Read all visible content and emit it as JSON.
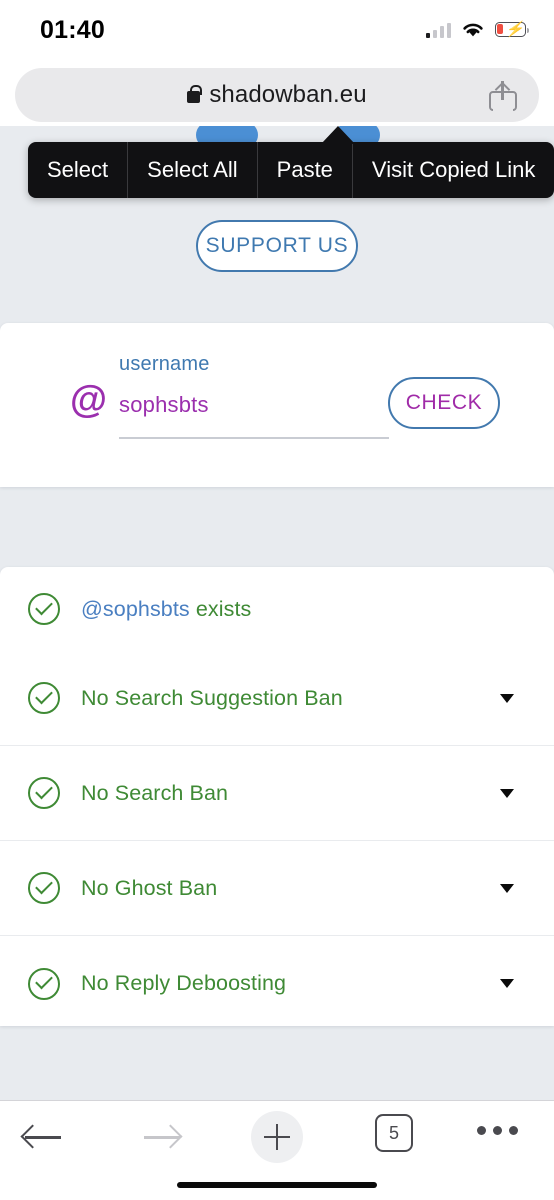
{
  "status_bar": {
    "time": "01:40",
    "signal_icon": "cellular-signal-icon",
    "wifi_icon": "wifi-icon",
    "battery_icon": "battery-charging-icon"
  },
  "browser": {
    "url": "shadowban.eu",
    "lock_icon": "lock-icon",
    "share_icon": "share-icon"
  },
  "context_menu": {
    "items": [
      {
        "label": "Select"
      },
      {
        "label": "Select All"
      },
      {
        "label": "Paste"
      },
      {
        "label": "Visit Copied Link"
      }
    ]
  },
  "page": {
    "support_button": "SUPPORT US",
    "form": {
      "at_symbol": "@",
      "label": "username",
      "value": "sophsbts",
      "placeholder": "username",
      "check_button": "CHECK"
    },
    "results": [
      {
        "status_icon": "check-circle-icon",
        "username": "@sophsbts",
        "suffix": " exists",
        "expandable": false
      },
      {
        "status_icon": "check-circle-icon",
        "label": "No Search Suggestion Ban",
        "expandable": true
      },
      {
        "status_icon": "check-circle-icon",
        "label": "No Search Ban",
        "expandable": true
      },
      {
        "status_icon": "check-circle-icon",
        "label": "No Ghost Ban",
        "expandable": true
      },
      {
        "status_icon": "check-circle-icon",
        "label": "No Reply Deboosting",
        "expandable": true
      }
    ]
  },
  "toolbar": {
    "back_icon": "back-arrow-icon",
    "forward_icon": "forward-arrow-icon",
    "new_tab_icon": "plus-icon",
    "tab_count": "5",
    "more_icon": "more-dots-icon"
  },
  "colors": {
    "page_background": "#e8ebef",
    "accent_blue": "#3f79b0",
    "accent_purple": "#9b2fae",
    "success_green": "#3f8a35",
    "battery_red": "#ef3b2d"
  }
}
